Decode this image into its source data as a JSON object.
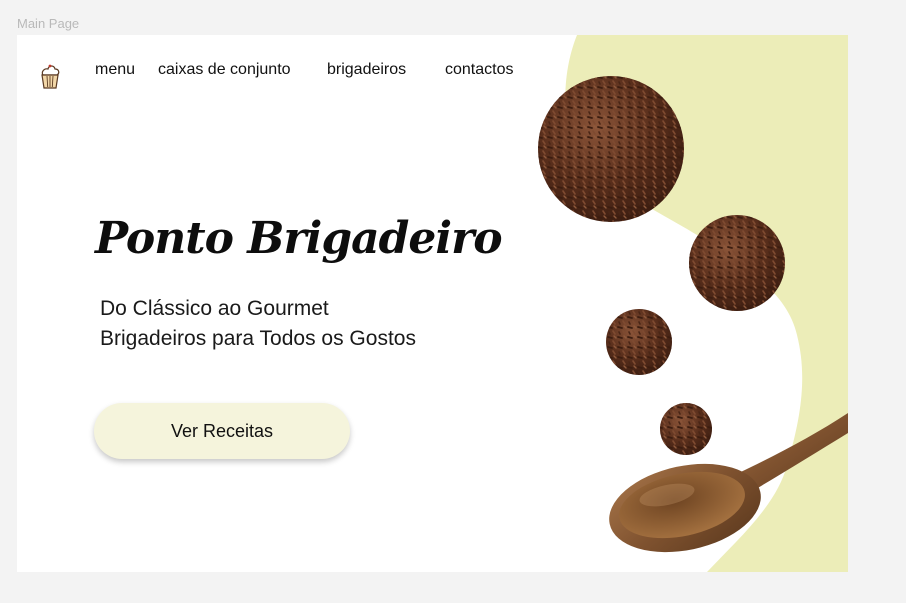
{
  "canvas": {
    "label": "Main Page"
  },
  "nav": {
    "logo_icon": "cupcake-icon",
    "items": [
      {
        "label": "menu"
      },
      {
        "label": "caixas de conjunto"
      },
      {
        "label": "brigadeiros"
      },
      {
        "label": "contactos"
      }
    ]
  },
  "hero": {
    "title": "Ponto Brigadeiro",
    "subtitle_line1": "Do Clássico ao Gourmet",
    "subtitle_line2": "Brigadeiros para Todos os Gostos",
    "cta_label": "Ver Receitas"
  },
  "colors": {
    "accent_blob": "#ecedb8",
    "button_bg": "#f5f4dc",
    "chocolate": "#5a2f1c",
    "wood": "#8a5a34"
  }
}
